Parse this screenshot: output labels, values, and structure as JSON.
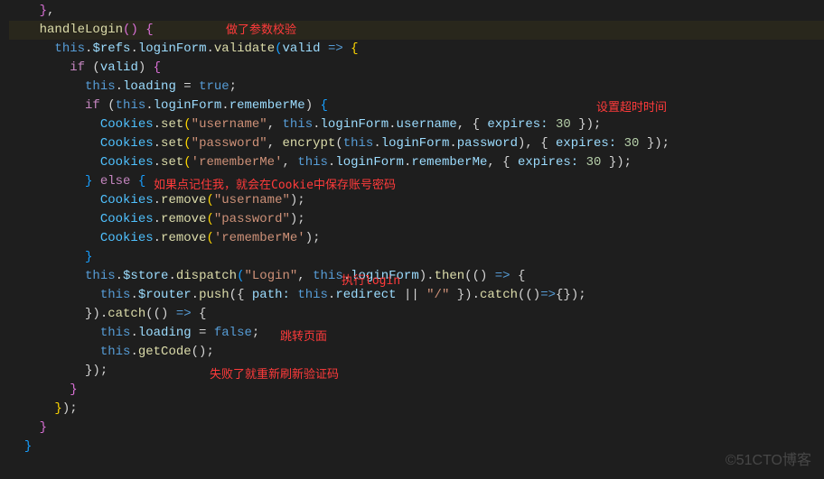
{
  "annotations": {
    "a1": "做了参数校验",
    "a2": "设置超时时间",
    "a3": "如果点记住我，就会在Cookie中保存账号密码",
    "a4": "执行login",
    "a5": "跳转页面",
    "a6": "失败了就重新刷新验证码"
  },
  "watermark": "©51CTO博客",
  "code": {
    "l01a": "    ",
    "l01b": "}",
    "l01c": ",",
    "l02a": "    ",
    "l02b": "handleLogin",
    "l02c": "(",
    "l02d": ")",
    "l02e": " ",
    "l02f": "{",
    "l03a": "      ",
    "l03b": "this",
    "l03c": ".",
    "l03d": "$refs",
    "l03e": ".",
    "l03f": "loginForm",
    "l03g": ".",
    "l03h": "validate",
    "l03i": "(",
    "l03j": "valid",
    "l03k": " ",
    "l03l": "=>",
    "l03m": " ",
    "l03n": "{",
    "l04a": "        ",
    "l04b": "if",
    "l04c": " (",
    "l04d": "valid",
    "l04e": ") ",
    "l04f": "{",
    "l05a": "          ",
    "l05b": "this",
    "l05c": ".",
    "l05d": "loading",
    "l05e": " = ",
    "l05f": "true",
    "l05g": ";",
    "l06a": "          ",
    "l06b": "if",
    "l06c": " (",
    "l06d": "this",
    "l06e": ".",
    "l06f": "loginForm",
    "l06g": ".",
    "l06h": "rememberMe",
    "l06i": ") ",
    "l06j": "{",
    "l07a": "            ",
    "l07b": "Cookies",
    "l07c": ".",
    "l07d": "set",
    "l07e": "(",
    "l07f": "\"username\"",
    "l07g": ", ",
    "l07h": "this",
    "l07i": ".",
    "l07j": "loginForm",
    "l07k": ".",
    "l07l": "username",
    "l07m": ", { ",
    "l07n": "expires:",
    "l07o": " ",
    "l07p": "30",
    "l07q": " });",
    "l08a": "            ",
    "l08b": "Cookies",
    "l08c": ".",
    "l08d": "set",
    "l08e": "(",
    "l08f": "\"password\"",
    "l08g": ", ",
    "l08h": "encrypt",
    "l08i": "(",
    "l08j": "this",
    "l08k": ".",
    "l08l": "loginForm",
    "l08m": ".",
    "l08n": "password",
    "l08o": "), { ",
    "l08p": "expires:",
    "l08q": " ",
    "l08r": "30",
    "l08s": " });",
    "l09a": "            ",
    "l09b": "Cookies",
    "l09c": ".",
    "l09d": "set",
    "l09e": "(",
    "l09f": "'rememberMe'",
    "l09g": ", ",
    "l09h": "this",
    "l09i": ".",
    "l09j": "loginForm",
    "l09k": ".",
    "l09l": "rememberMe",
    "l09m": ", { ",
    "l09n": "expires:",
    "l09o": " ",
    "l09p": "30",
    "l09q": " });",
    "l10a": "          ",
    "l10b": "}",
    "l10c": " ",
    "l10d": "else",
    "l10e": " ",
    "l10f": "{",
    "l11a": "            ",
    "l11b": "Cookies",
    "l11c": ".",
    "l11d": "remove",
    "l11e": "(",
    "l11f": "\"username\"",
    "l11g": ");",
    "l12a": "            ",
    "l12b": "Cookies",
    "l12c": ".",
    "l12d": "remove",
    "l12e": "(",
    "l12f": "\"password\"",
    "l12g": ");",
    "l13a": "            ",
    "l13b": "Cookies",
    "l13c": ".",
    "l13d": "remove",
    "l13e": "(",
    "l13f": "'rememberMe'",
    "l13g": ");",
    "l14a": "          ",
    "l14b": "}",
    "l15a": "          ",
    "l15b": "this",
    "l15c": ".",
    "l15d": "$store",
    "l15e": ".",
    "l15f": "dispatch",
    "l15g": "(",
    "l15h": "\"Login\"",
    "l15i": ", ",
    "l15j": "this",
    "l15k": ".",
    "l15l": "loginForm",
    "l15m": ").",
    "l15n": "then",
    "l15o": "(() ",
    "l15p": "=>",
    "l15q": " {",
    "l16a": "            ",
    "l16b": "this",
    "l16c": ".",
    "l16d": "$router",
    "l16e": ".",
    "l16f": "push",
    "l16g": "({ ",
    "l16h": "path:",
    "l16i": " ",
    "l16j": "this",
    "l16k": ".",
    "l16l": "redirect",
    "l16m": " || ",
    "l16n": "\"/\"",
    "l16o": " }).",
    "l16p": "catch",
    "l16q": "(()",
    "l16r": "=>",
    "l16s": "{});",
    "l17a": "          }).",
    "l17b": "catch",
    "l17c": "(() ",
    "l17d": "=>",
    "l17e": " {",
    "l18a": "            ",
    "l18b": "this",
    "l18c": ".",
    "l18d": "loading",
    "l18e": " = ",
    "l18f": "false",
    "l18g": ";",
    "l19a": "            ",
    "l19b": "this",
    "l19c": ".",
    "l19d": "getCode",
    "l19e": "();",
    "l20a": "          });",
    "l21a": "        ",
    "l21b": "}",
    "l22a": "      ",
    "l22b": "}",
    "l22c": ");",
    "l23a": "    ",
    "l23b": "}",
    "l24a": "  ",
    "l24b": "}"
  }
}
